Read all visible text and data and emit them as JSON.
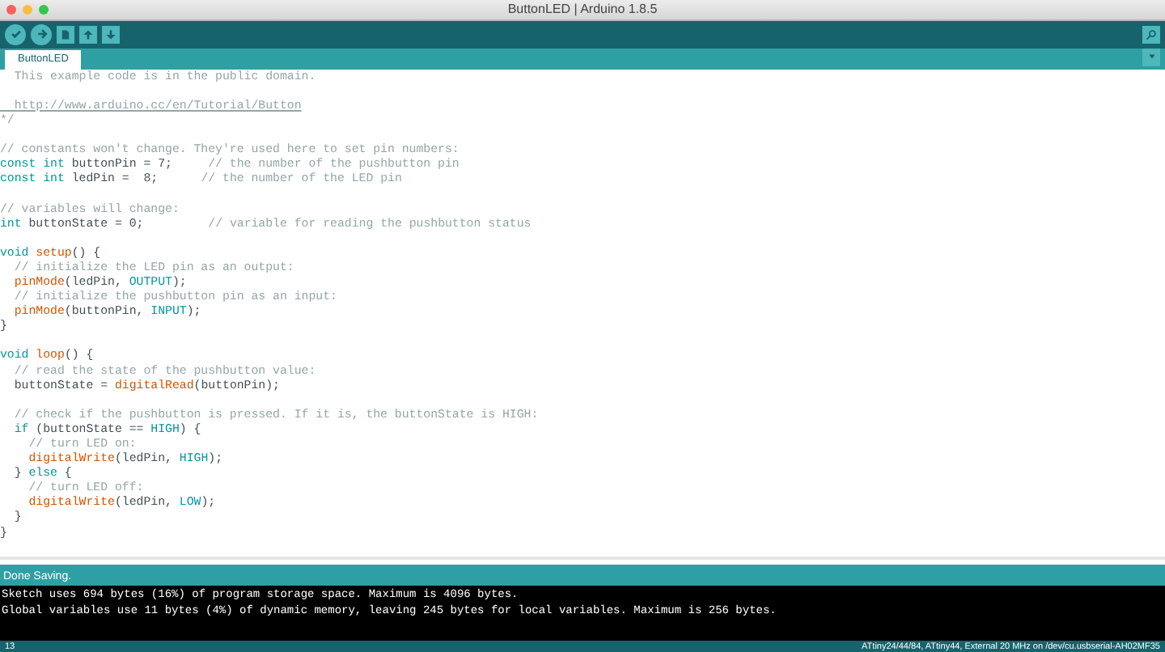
{
  "window": {
    "title": "ButtonLED | Arduino 1.8.5"
  },
  "tabs": [
    {
      "label": "ButtonLED",
      "selected": true
    }
  ],
  "code_blocks": [
    [
      [
        {
          "kind": "comment",
          "text": "  This example code is in the public domain."
        }
      ]
    ],
    [
      [
        {
          "kind": "link",
          "text": "  http://www.arduino.cc/en/Tutorial/Button"
        }
      ],
      [
        {
          "kind": "comment",
          "text": "*/"
        }
      ]
    ],
    [
      [
        {
          "kind": "comment",
          "text": "// constants won't change. They're used here to set pin numbers:"
        }
      ],
      [
        {
          "kind": "keyword",
          "text": "const int"
        },
        {
          "kind": "plain",
          "text": " buttonPin = 7;     "
        },
        {
          "kind": "comment",
          "text": "// the number of the pushbutton pin"
        }
      ],
      [
        {
          "kind": "keyword",
          "text": "const int"
        },
        {
          "kind": "plain",
          "text": " ledPin =  8;      "
        },
        {
          "kind": "comment",
          "text": "// the number of the LED pin"
        }
      ]
    ],
    [
      [
        {
          "kind": "comment",
          "text": "// variables will change:"
        }
      ],
      [
        {
          "kind": "keyword",
          "text": "int"
        },
        {
          "kind": "plain",
          "text": " buttonState = 0;         "
        },
        {
          "kind": "comment",
          "text": "// variable for reading the pushbutton status"
        }
      ]
    ],
    [
      [
        {
          "kind": "keyword",
          "text": "void"
        },
        {
          "kind": "function",
          "text": " setup"
        },
        {
          "kind": "plain",
          "text": "() {"
        }
      ],
      [
        {
          "kind": "comment",
          "text": "  // initialize the LED pin as an output:"
        }
      ],
      [
        {
          "kind": "function",
          "text": "  pinMode"
        },
        {
          "kind": "plain",
          "text": "(ledPin, "
        },
        {
          "kind": "constant",
          "text": "OUTPUT"
        },
        {
          "kind": "plain",
          "text": ");"
        }
      ],
      [
        {
          "kind": "comment",
          "text": "  // initialize the pushbutton pin as an input:"
        }
      ],
      [
        {
          "kind": "function",
          "text": "  pinMode"
        },
        {
          "kind": "plain",
          "text": "(buttonPin, "
        },
        {
          "kind": "constant",
          "text": "INPUT"
        },
        {
          "kind": "plain",
          "text": ");"
        }
      ],
      [
        {
          "kind": "plain",
          "text": "}"
        }
      ]
    ],
    [
      [
        {
          "kind": "keyword",
          "text": "void"
        },
        {
          "kind": "function",
          "text": " loop"
        },
        {
          "kind": "plain",
          "text": "() {"
        }
      ],
      [
        {
          "kind": "comment",
          "text": "  // read the state of the pushbutton value:"
        }
      ],
      [
        {
          "kind": "plain",
          "text": "  buttonState = "
        },
        {
          "kind": "function",
          "text": "digitalRead"
        },
        {
          "kind": "plain",
          "text": "(buttonPin);"
        }
      ]
    ],
    [
      [
        {
          "kind": "comment",
          "text": "  // check if the pushbutton is pressed. If it is, the buttonState is HIGH:"
        }
      ],
      [
        {
          "kind": "keyword",
          "text": "  if"
        },
        {
          "kind": "plain",
          "text": " (buttonState == "
        },
        {
          "kind": "constant",
          "text": "HIGH"
        },
        {
          "kind": "plain",
          "text": ") {"
        }
      ],
      [
        {
          "kind": "comment",
          "text": "    // turn LED on:"
        }
      ],
      [
        {
          "kind": "function",
          "text": "    digitalWrite"
        },
        {
          "kind": "plain",
          "text": "(ledPin, "
        },
        {
          "kind": "constant",
          "text": "HIGH"
        },
        {
          "kind": "plain",
          "text": ");"
        }
      ],
      [
        {
          "kind": "plain",
          "text": "  }"
        },
        {
          "kind": "keyword",
          "text": " else"
        },
        {
          "kind": "plain",
          "text": " {"
        }
      ],
      [
        {
          "kind": "comment",
          "text": "    // turn LED off:"
        }
      ],
      [
        {
          "kind": "function",
          "text": "    digitalWrite"
        },
        {
          "kind": "plain",
          "text": "(ledPin, "
        },
        {
          "kind": "constant",
          "text": "LOW"
        },
        {
          "kind": "plain",
          "text": ");"
        }
      ],
      [
        {
          "kind": "plain",
          "text": "  }"
        }
      ],
      [
        {
          "kind": "plain",
          "text": "}"
        }
      ]
    ]
  ],
  "status": "Done Saving.",
  "console": [
    "Sketch uses 694 bytes (16%) of program storage space. Maximum is 4096 bytes.",
    "Global variables use 11 bytes (4%) of dynamic memory, leaving 245 bytes for local variables. Maximum is 256 bytes."
  ],
  "footer": {
    "line": "13",
    "board": "ATtiny24/44/84, ATtiny44, External 20 MHz on /dev/cu.usbserial-AH02MF35"
  }
}
